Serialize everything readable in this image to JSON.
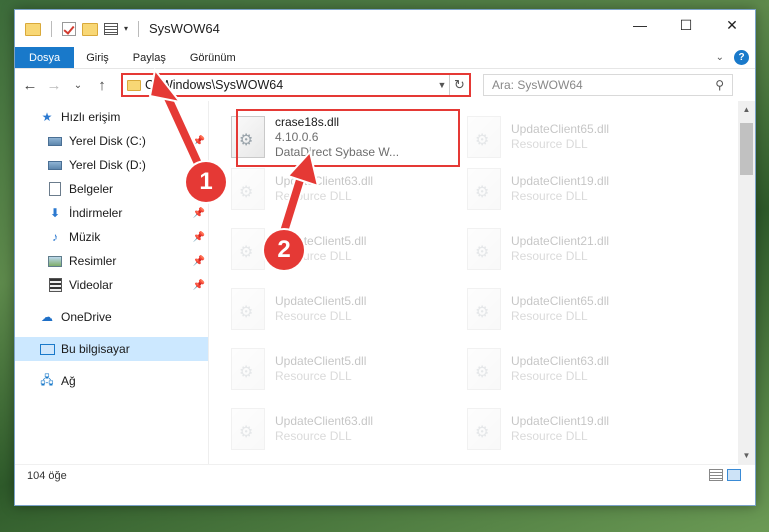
{
  "window": {
    "title": "SysWOW64",
    "controls": {
      "minimize": "—",
      "maximize": "☐",
      "close": "✕"
    }
  },
  "ribbon": {
    "tabs": [
      "Dosya",
      "Giriş",
      "Paylaş",
      "Görünüm"
    ],
    "help": "?"
  },
  "nav": {
    "back": "←",
    "forward": "→",
    "recent": "⌄",
    "up": "↑"
  },
  "address": {
    "path": "C:\\Windows\\SysWOW64",
    "refresh": "↻"
  },
  "search": {
    "placeholder": "Ara: SysWOW64"
  },
  "sidebar": {
    "items": [
      {
        "label": "Hızlı erişim",
        "icon": "star-icon"
      },
      {
        "label": "Yerel Disk (C:)",
        "icon": "drive-icon",
        "pinned": true
      },
      {
        "label": "Yerel Disk (D:)",
        "icon": "drive-icon"
      },
      {
        "label": "Belgeler",
        "icon": "documents-icon",
        "pinned": true
      },
      {
        "label": "İndirmeler",
        "icon": "download-icon",
        "pinned": true
      },
      {
        "label": "Müzik",
        "icon": "music-icon",
        "pinned": true
      },
      {
        "label": "Resimler",
        "icon": "pictures-icon",
        "pinned": true
      },
      {
        "label": "Videolar",
        "icon": "videos-icon",
        "pinned": true
      },
      {
        "label": "OneDrive",
        "icon": "cloud-icon"
      },
      {
        "label": "Bu bilgisayar",
        "icon": "computer-icon",
        "selected": true
      },
      {
        "label": "Ağ",
        "icon": "network-icon"
      }
    ]
  },
  "files": [
    {
      "name": "crase18s.dll",
      "line2": "4.10.0.6",
      "line3": "DataDirect Sybase W...",
      "highlighted": true
    },
    {
      "name": "UpdateClient65.dll",
      "line2": "Resource DLL"
    },
    {
      "name": "UpdateClient63.dll",
      "line2": "Resource DLL"
    },
    {
      "name": "UpdateClient19.dll",
      "line2": "Resource DLL"
    },
    {
      "name": "UpdateClient5.dll",
      "line2": "Resource DLL"
    },
    {
      "name": "UpdateClient21.dll",
      "line2": "Resource DLL"
    },
    {
      "name": "UpdateClient5.dll",
      "line2": "Resource DLL"
    },
    {
      "name": "UpdateClient65.dll",
      "line2": "Resource DLL"
    },
    {
      "name": "UpdateClient5.dll",
      "line2": "Resource DLL"
    },
    {
      "name": "UpdateClient63.dll",
      "line2": "Resource DLL"
    },
    {
      "name": "UpdateClient63.dll",
      "line2": "Resource DLL"
    },
    {
      "name": "UpdateClient19.dll",
      "line2": "Resource DLL"
    }
  ],
  "status": {
    "count": "104 öğe"
  },
  "callouts": [
    "1",
    "2"
  ],
  "colors": {
    "accent": "#1979ca",
    "highlight": "#e53935",
    "selected": "#cce8ff"
  }
}
